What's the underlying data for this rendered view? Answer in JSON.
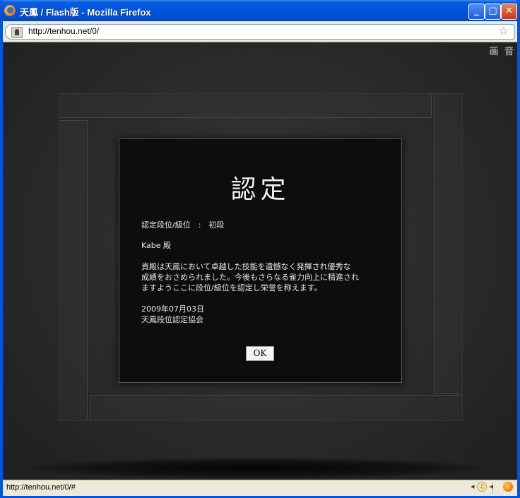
{
  "window": {
    "title": "天鳳 / Flash版 - Mozilla Firefox",
    "minimize_glyph": "_",
    "maximize_glyph": "□",
    "close_glyph": "✕"
  },
  "urlbar": {
    "url": "http://tenhou.net/0/"
  },
  "page": {
    "corner_labels": "画 音"
  },
  "dialog": {
    "title": "認定",
    "rank_line": "認定段位/級位　:　初段",
    "recipient": "Kabe 殿",
    "body_lines": [
      "貴殿は天鳳において卓越した技能を遺憾なく発揮され優秀な",
      "成績をおさめられました。今後もさらなる雀力向上に精進され",
      "ますようここに段位/級位を認定し栄誉を称えます。"
    ],
    "date": "2009年07月03日",
    "issuer": "天鳳段位認定協会",
    "ok_label": "OK"
  },
  "statusbar": {
    "text": "http://tenhou.net/0/#"
  }
}
